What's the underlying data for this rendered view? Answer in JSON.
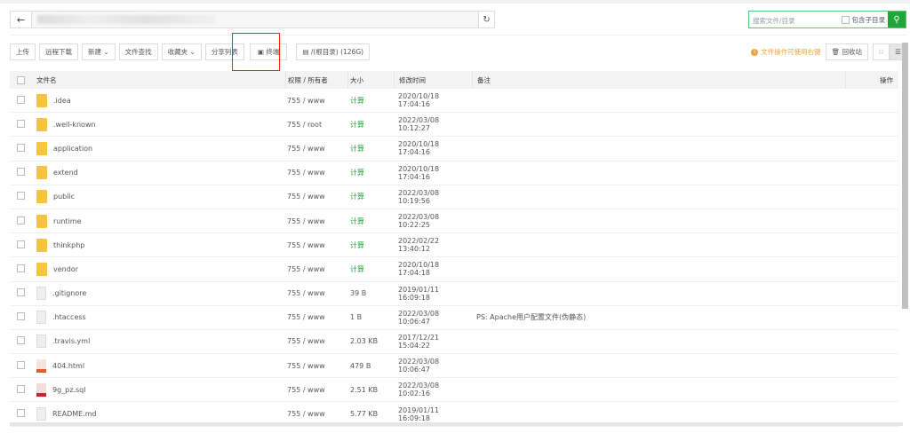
{
  "toolbar": {
    "upload": "上传",
    "remote_download": "远程下载",
    "new": "新建",
    "find": "文件查找",
    "favorites": "收藏夹",
    "share_list": "分享列表",
    "terminal": "终端",
    "disk": "/(根目录) (126G)"
  },
  "search": {
    "placeholder": "搜索文件/目录",
    "include_sub": "包含子目录"
  },
  "right": {
    "tip": "文件操作可使用右键",
    "recycle": "回收站"
  },
  "columns": {
    "name": "文件名",
    "perm": "权限 / 所有者",
    "size": "大小",
    "mtime": "修改时间",
    "note": "备注",
    "ops": "操作"
  },
  "rows": [
    {
      "icon": "folder",
      "name": ".idea",
      "perm": "755 / www",
      "size": "计算",
      "mtime": "2020/10/18 17:04:16",
      "note": ""
    },
    {
      "icon": "folder",
      "name": ".well-known",
      "perm": "755 / root",
      "size": "计算",
      "mtime": "2022/03/08 10:12:27",
      "note": ""
    },
    {
      "icon": "folder",
      "name": "application",
      "perm": "755 / www",
      "size": "计算",
      "mtime": "2020/10/18 17:04:16",
      "note": ""
    },
    {
      "icon": "folder",
      "name": "extend",
      "perm": "755 / www",
      "size": "计算",
      "mtime": "2020/10/18 17:04:16",
      "note": ""
    },
    {
      "icon": "folder",
      "name": "public",
      "perm": "755 / www",
      "size": "计算",
      "mtime": "2022/03/08 10:19:56",
      "note": ""
    },
    {
      "icon": "folder",
      "name": "runtime",
      "perm": "755 / www",
      "size": "计算",
      "mtime": "2022/03/08 10:22:25",
      "note": ""
    },
    {
      "icon": "folder",
      "name": "thinkphp",
      "perm": "755 / www",
      "size": "计算",
      "mtime": "2022/02/22 13:40:12",
      "note": ""
    },
    {
      "icon": "folder",
      "name": "vendor",
      "perm": "755 / www",
      "size": "计算",
      "mtime": "2020/10/18 17:04:18",
      "note": ""
    },
    {
      "icon": "file",
      "name": ".gitignore",
      "perm": "755 / www",
      "size": "39 B",
      "mtime": "2019/01/11 16:09:18",
      "note": ""
    },
    {
      "icon": "file",
      "name": ".htaccess",
      "perm": "755 / www",
      "size": "1 B",
      "mtime": "2022/03/08 10:06:47",
      "note": "PS: Apache用户配置文件(伪静态)"
    },
    {
      "icon": "file",
      "name": ".travis.yml",
      "perm": "755 / www",
      "size": "2.03 KB",
      "mtime": "2017/12/21 15:04:22",
      "note": ""
    },
    {
      "icon": "html",
      "name": "404.html",
      "perm": "755 / www",
      "size": "479 B",
      "mtime": "2022/03/08 10:06:47",
      "note": ""
    },
    {
      "icon": "sql",
      "name": "9g_pz.sql",
      "perm": "755 / www",
      "size": "2.51 KB",
      "mtime": "2022/03/08 10:02:16",
      "note": ""
    },
    {
      "icon": "file",
      "name": "README.md",
      "perm": "755 / www",
      "size": "5.77 KB",
      "mtime": "2019/01/11 16:09:18",
      "note": ""
    }
  ]
}
